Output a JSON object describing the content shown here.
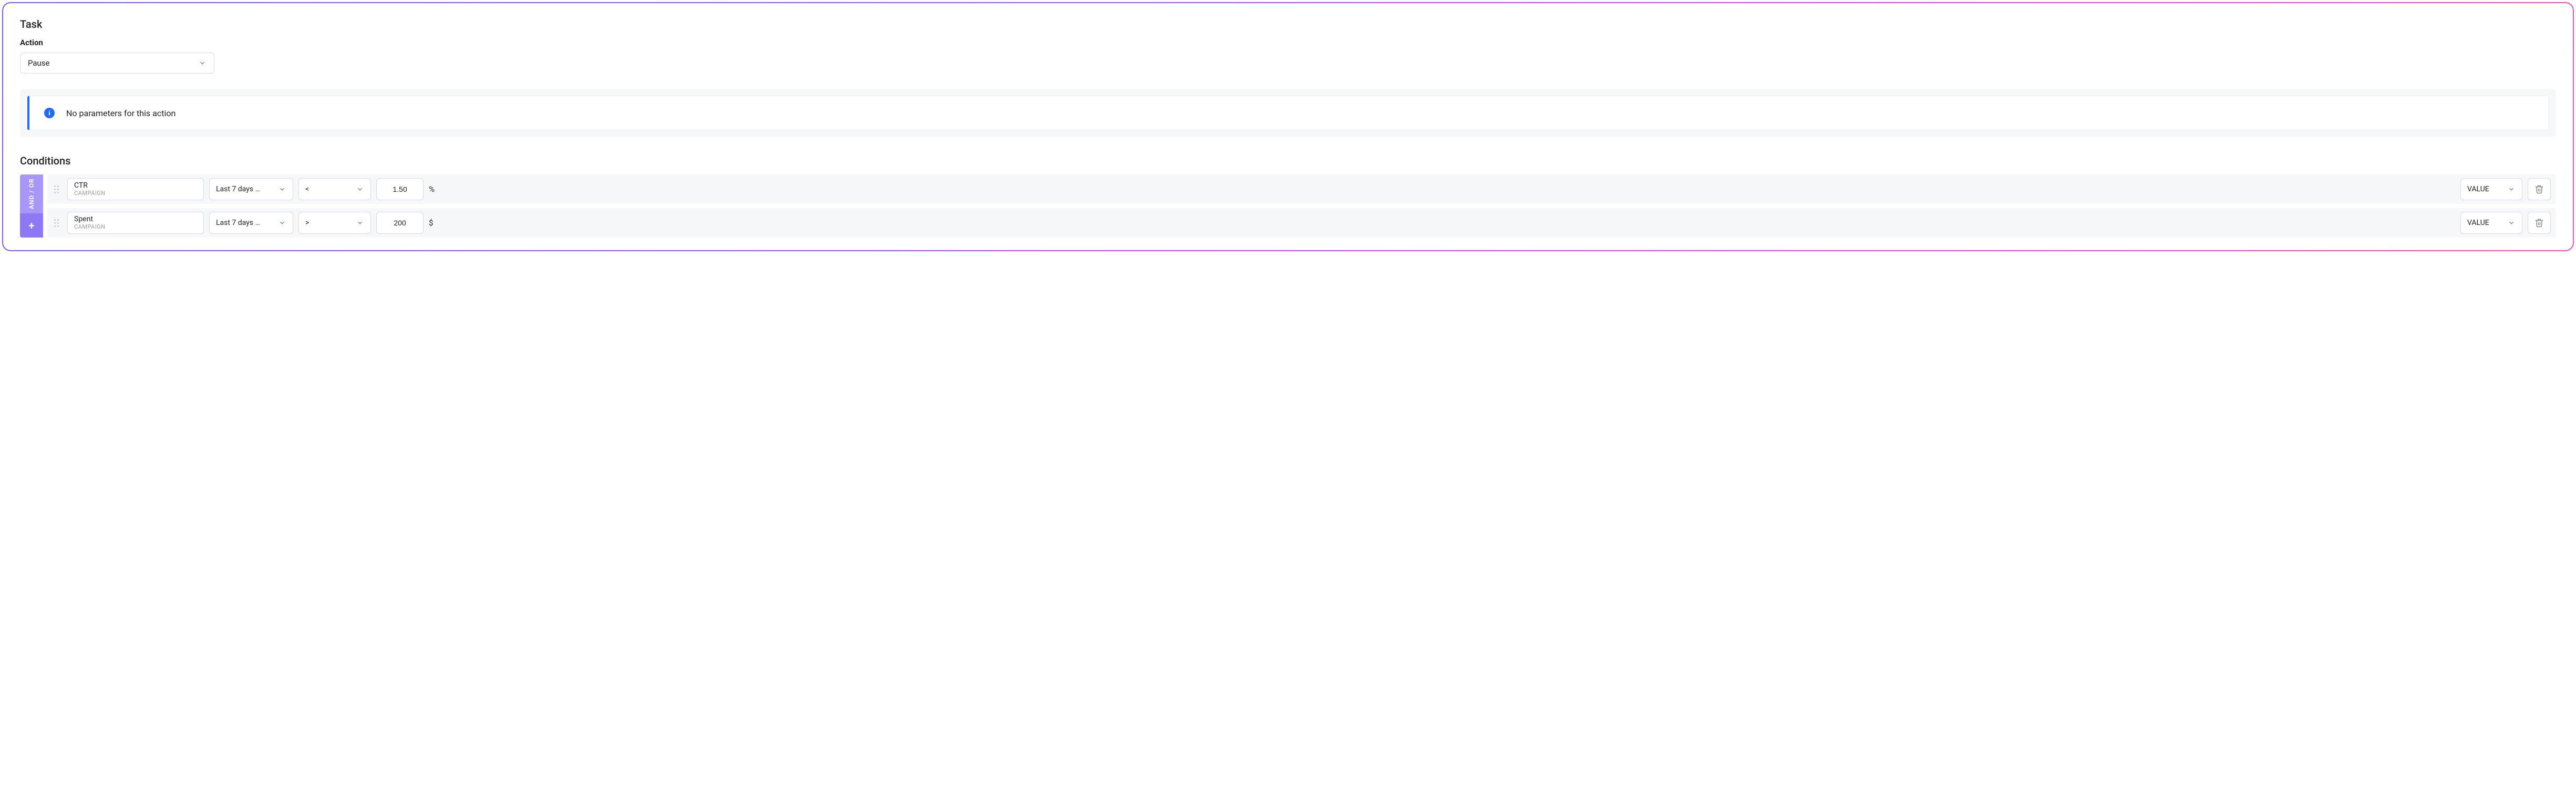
{
  "task": {
    "section_title": "Task",
    "action_label": "Action",
    "action_value": "Pause",
    "info_message": "No parameters for this action"
  },
  "conditions": {
    "section_title": "Conditions",
    "andor_label": "AND / OR",
    "add_label": "+",
    "rows": [
      {
        "metric": "CTR",
        "scope": "CAMPAIGN",
        "range": "Last 7 days …",
        "operator": "<",
        "value": "1.50",
        "unit": "%",
        "value_type": "VALUE"
      },
      {
        "metric": "Spent",
        "scope": "CAMPAIGN",
        "range": "Last 7 days …",
        "operator": ">",
        "value": "200",
        "unit": "$",
        "value_type": "VALUE"
      }
    ]
  }
}
